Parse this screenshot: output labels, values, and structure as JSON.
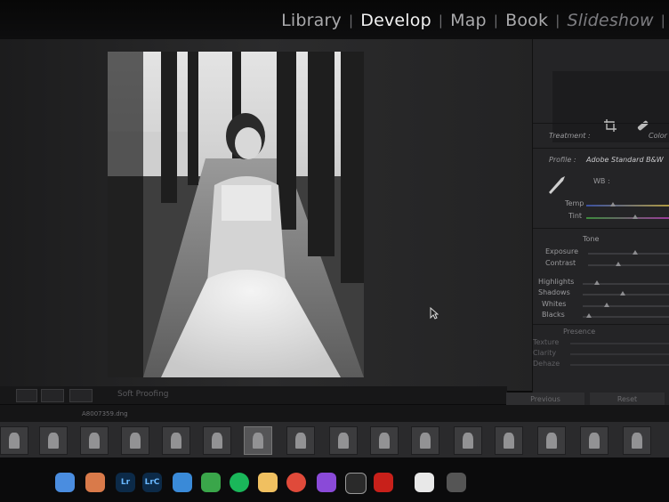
{
  "modules": {
    "items": [
      "Library",
      "Develop",
      "Map",
      "Book",
      "Slideshow"
    ],
    "separator": "|",
    "active": "Develop"
  },
  "toolbar": {
    "soft_proofing": "Soft Proofing"
  },
  "panel": {
    "treatment_label": "Treatment :",
    "treatment_value": "Color",
    "profile_label": "Profile :",
    "profile_value": "Adobe Standard B&W",
    "wb_label": "WB :",
    "temp_label": "Temp",
    "tint_label": "Tint",
    "tone_header": "Tone",
    "exposure_label": "Exposure",
    "contrast_label": "Contrast",
    "highlights_label": "Highlights",
    "shadows_label": "Shadows",
    "whites_label": "Whites",
    "blacks_label": "Blacks",
    "presence_header": "Presence",
    "texture_label": "Texture",
    "clarity_label": "Clarity",
    "dehaze_label": "Dehaze",
    "previous_button": "Previous",
    "reset_button": "Reset"
  },
  "filmstrip": {
    "filename": "A8007359.dng",
    "thumb_count": 16,
    "selected_index": 6
  },
  "dock": {
    "icons": [
      "finder-icon",
      "launchpad-icon",
      "lightroom-classic-icon",
      "lightroom-icon",
      "safari-icon",
      "messages-icon",
      "spotify-icon",
      "notes-icon",
      "chrome-icon",
      "podcasts-icon",
      "camera-app-icon",
      "acrobat-icon",
      "calendar-icon",
      "trash-icon"
    ],
    "labels": {
      "lightroom-classic-icon": "Lr",
      "lightroom-icon": "LrC"
    }
  },
  "colors": {
    "active_module": "#f2f2f2",
    "inactive_module": "#a9a9ab",
    "panel_bg": "#242426"
  }
}
